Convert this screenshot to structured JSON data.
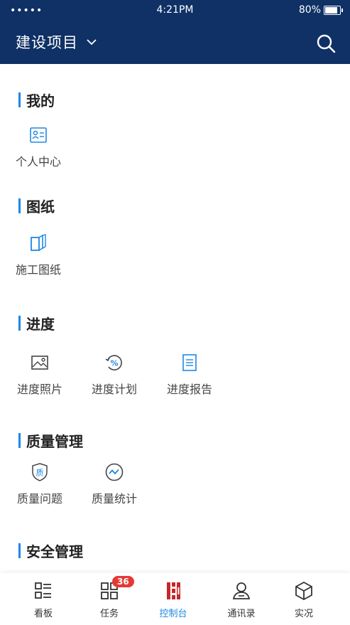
{
  "status_bar": {
    "signal": "•••••",
    "time": "4:21PM",
    "battery": "80%"
  },
  "header": {
    "title": "建设项目"
  },
  "sections": [
    {
      "title": "我的",
      "items": [
        {
          "label": "个人中心",
          "icon": "profile-card-icon"
        }
      ]
    },
    {
      "title": "图纸",
      "items": [
        {
          "label": "施工图纸",
          "icon": "drawings-icon"
        }
      ]
    },
    {
      "title": "进度",
      "items": [
        {
          "label": "进度照片",
          "icon": "photo-icon"
        },
        {
          "label": "进度计划",
          "icon": "percent-cycle-icon"
        },
        {
          "label": "进度报告",
          "icon": "document-icon"
        }
      ]
    },
    {
      "title": "质量管理",
      "items": [
        {
          "label": "质量问题",
          "icon": "quality-shield-icon",
          "glyph": "质"
        },
        {
          "label": "质量统计",
          "icon": "trend-circle-icon"
        }
      ]
    },
    {
      "title": "安全管理",
      "items": []
    }
  ],
  "tabbar": {
    "items": [
      {
        "label": "看板",
        "icon": "dashboard-list-icon"
      },
      {
        "label": "任务",
        "icon": "grid-icon",
        "badge": "36"
      },
      {
        "label": "控制台",
        "icon": "console-icon",
        "active": true
      },
      {
        "label": "通讯录",
        "icon": "contacts-icon"
      },
      {
        "label": "实况",
        "icon": "cube-icon"
      }
    ]
  },
  "colors": {
    "header_bg": "#0f3165",
    "accent": "#1e88e5",
    "badge": "#e53935",
    "console_red": "#c62828"
  }
}
